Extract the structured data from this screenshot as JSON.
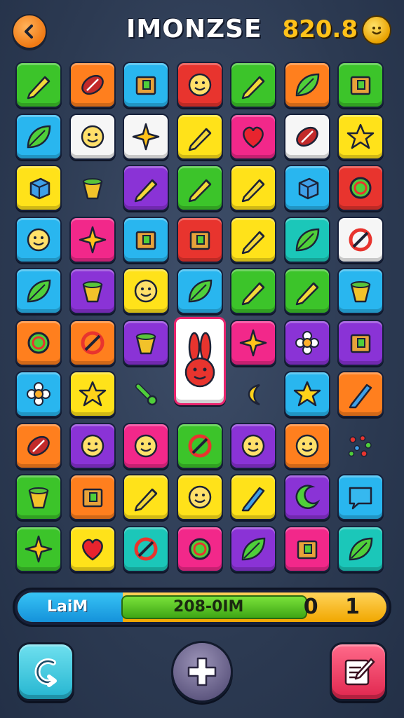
{
  "header": {
    "title": "IMONZSE",
    "score": "820.8",
    "back_icon": "chevron-left-icon",
    "coin_icon": "smiley-coin-icon"
  },
  "board": {
    "rows": 10,
    "cols": 7,
    "tiles": [
      [
        "green",
        "rocket"
      ],
      [
        "orange",
        "football"
      ],
      [
        "blue",
        "shrine"
      ],
      [
        "red",
        "cat-face"
      ],
      [
        "green",
        "crayon"
      ],
      [
        "orange",
        "feather"
      ],
      [
        "green",
        "potion"
      ],
      [
        "blue",
        "bird"
      ],
      [
        "white",
        "chef-face"
      ],
      [
        "white",
        "star-burst"
      ],
      [
        "yellow",
        "magic-wand"
      ],
      [
        "pink",
        "heart"
      ],
      [
        "white",
        "melon"
      ],
      [
        "yellow",
        "star"
      ],
      [
        "yellow",
        "cube"
      ],
      [
        "none",
        "cup"
      ],
      [
        "purple",
        "crayon"
      ],
      [
        "green",
        "battery"
      ],
      [
        "yellow",
        "mace"
      ],
      [
        "blue",
        "dice"
      ],
      [
        "red",
        "spiral"
      ],
      [
        "blue",
        "flower-face"
      ],
      [
        "pink",
        "sparkle"
      ],
      [
        "blue",
        "crate"
      ],
      [
        "red",
        "block"
      ],
      [
        "yellow",
        "rocket"
      ],
      [
        "teal",
        "leaf"
      ],
      [
        "white",
        "cross"
      ],
      [
        "blue",
        "maple-leaf"
      ],
      [
        "purple",
        "bowl"
      ],
      [
        "yellow",
        "ghost"
      ],
      [
        "blue",
        "leaf"
      ],
      [
        "green",
        "pencil-tip"
      ],
      [
        "green",
        "brush"
      ],
      [
        "blue",
        "can"
      ],
      [
        "orange",
        "swirl"
      ],
      [
        "orange",
        "compass"
      ],
      [
        "purple",
        "salad"
      ],
      [
        "big",
        "bunny"
      ],
      [
        "pink",
        "starfish"
      ],
      [
        "purple",
        "sun"
      ],
      [
        "purple",
        "square"
      ],
      [
        "blue",
        "gear-flower"
      ],
      [
        "yellow",
        "star"
      ],
      [
        "none",
        "pin"
      ],
      [
        "none",
        "skip"
      ],
      [
        "none",
        "crescent"
      ],
      [
        "blue",
        "star"
      ],
      [
        "orange",
        "pen"
      ],
      [
        "orange",
        "football"
      ],
      [
        "purple",
        "smile"
      ],
      [
        "pink",
        "monster"
      ],
      [
        "green",
        "no-sign"
      ],
      [
        "purple",
        "eyes"
      ],
      [
        "orange",
        "flower-face"
      ],
      [
        "none",
        "berries"
      ],
      [
        "green",
        "cup-drink"
      ],
      [
        "orange",
        "bag"
      ],
      [
        "yellow",
        "guitar"
      ],
      [
        "yellow",
        "crown-face"
      ],
      [
        "yellow",
        "pencil"
      ],
      [
        "purple",
        "moon"
      ],
      [
        "blue",
        "speech"
      ],
      [
        "green",
        "sparkle"
      ],
      [
        "yellow",
        "heart"
      ],
      [
        "teal",
        "no-sign"
      ],
      [
        "pink",
        "ring"
      ],
      [
        "purple",
        "diamond"
      ],
      [
        "pink",
        "box"
      ],
      [
        "teal",
        "tree"
      ]
    ]
  },
  "progress": {
    "label": "LaiM",
    "value_text": "208-0IM",
    "count": "0 1",
    "fill_fraction": 0.6
  },
  "controls": {
    "left_icon": "swap-arrow-icon",
    "center_icon": "plus-icon",
    "right_icon": "edit-icon"
  },
  "colors": {
    "green": "#3cc42a",
    "orange": "#ff7f1e",
    "blue": "#29b6ef",
    "red": "#e8342e",
    "yellow": "#ffe21a",
    "white": "#f6f6f6",
    "purple": "#8a33d6",
    "pink": "#f2288a",
    "teal": "#1bc7b9"
  }
}
